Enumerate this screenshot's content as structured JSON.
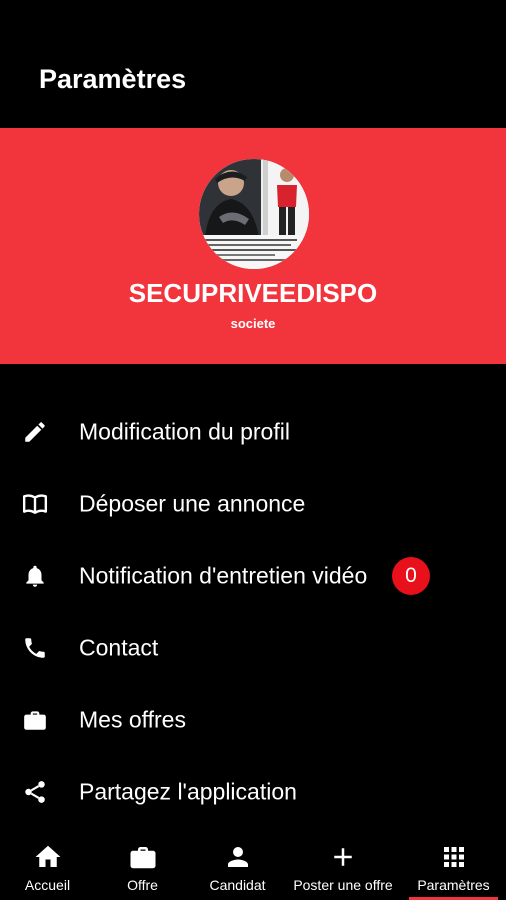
{
  "appbar": {
    "title": "Paramètres"
  },
  "profile": {
    "name": "SECUPRIVEEDISPO",
    "type": "societe"
  },
  "menu": {
    "items": [
      {
        "label": "Modification du profil",
        "icon": "pencil-icon"
      },
      {
        "label": "Déposer une annonce",
        "icon": "book-icon"
      },
      {
        "label": "Notification d'entretien vidéo",
        "icon": "bell-icon",
        "badge": "0"
      },
      {
        "label": "Contact",
        "icon": "phone-icon"
      },
      {
        "label": "Mes offres",
        "icon": "briefcase-icon"
      },
      {
        "label": "Partagez l'application",
        "icon": "share-icon"
      }
    ]
  },
  "navbar": {
    "items": [
      {
        "label": "Accueil",
        "icon": "home-icon"
      },
      {
        "label": "Offre",
        "icon": "briefcase-icon"
      },
      {
        "label": "Candidat",
        "icon": "person-icon"
      },
      {
        "label": "Poster une offre",
        "icon": "plus-icon"
      },
      {
        "label": "Paramètres",
        "icon": "grid-icon",
        "active": true
      }
    ]
  },
  "colors": {
    "accent": "#f2343d",
    "background": "#000000",
    "badge": "#e8101a",
    "text": "#ffffff"
  }
}
